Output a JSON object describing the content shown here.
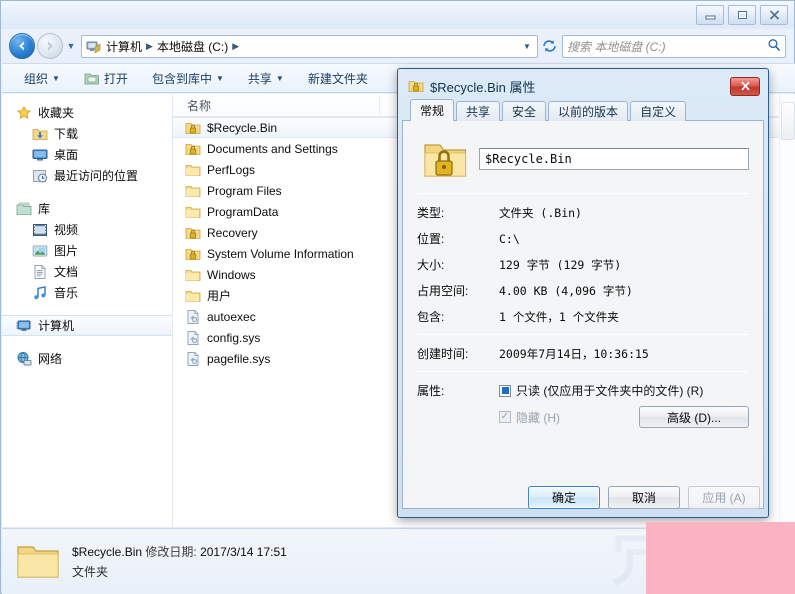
{
  "window": {
    "title_icon": "computer-icon",
    "buttons": {
      "minimize": "–",
      "maximize": "□",
      "close": "✕"
    }
  },
  "address": {
    "crumb_icon": "computer-drive-icon",
    "crumbs": [
      "计算机",
      "本地磁盘 (C:)"
    ],
    "separator": "▶",
    "dropdown": "▼",
    "refresh_icon": "refresh-icon"
  },
  "search": {
    "placeholder": "搜索 本地磁盘 (C:)",
    "icon": "search-icon"
  },
  "commandbar": {
    "items": [
      {
        "label": "组织",
        "caret": "▼",
        "icon": null
      },
      {
        "label": "打开",
        "caret": "",
        "icon": "open-folder-icon"
      },
      {
        "label": "包含到库中",
        "caret": "▼",
        "icon": null
      },
      {
        "label": "共享",
        "caret": "▼",
        "icon": null
      },
      {
        "label": "新建文件夹",
        "caret": "",
        "icon": null
      }
    ]
  },
  "navpane": {
    "groups": [
      {
        "header": {
          "label": "收藏夹",
          "icon": "star-icon"
        },
        "items": [
          {
            "label": "下载",
            "icon": "download-folder-icon"
          },
          {
            "label": "桌面",
            "icon": "desktop-icon"
          },
          {
            "label": "最近访问的位置",
            "icon": "recent-places-icon"
          }
        ]
      },
      {
        "header": {
          "label": "库",
          "icon": "library-icon"
        },
        "items": [
          {
            "label": "视频",
            "icon": "videos-icon"
          },
          {
            "label": "图片",
            "icon": "pictures-icon"
          },
          {
            "label": "文档",
            "icon": "documents-icon"
          },
          {
            "label": "音乐",
            "icon": "music-icon"
          }
        ]
      },
      {
        "header": {
          "label": "计算机",
          "icon": "computer-icon",
          "selected": true
        },
        "items": []
      },
      {
        "header": {
          "label": "网络",
          "icon": "network-icon"
        },
        "items": []
      }
    ]
  },
  "filelist": {
    "column_header": "名称",
    "sort_indicator": "▲",
    "rows": [
      {
        "name": "$Recycle.Bin",
        "icon": "locked-folder-icon",
        "selected": true
      },
      {
        "name": "Documents and Settings",
        "icon": "locked-folder-icon",
        "selected": false
      },
      {
        "name": "PerfLogs",
        "icon": "folder-icon",
        "selected": false
      },
      {
        "name": "Program Files",
        "icon": "folder-icon",
        "selected": false
      },
      {
        "name": "ProgramData",
        "icon": "folder-icon",
        "selected": false
      },
      {
        "name": "Recovery",
        "icon": "locked-folder-icon",
        "selected": false
      },
      {
        "name": "System Volume Information",
        "icon": "locked-folder-icon",
        "selected": false
      },
      {
        "name": "Windows",
        "icon": "folder-icon",
        "selected": false
      },
      {
        "name": "用户",
        "icon": "folder-icon",
        "selected": false
      },
      {
        "name": "autoexec",
        "icon": "system-file-icon",
        "selected": false
      },
      {
        "name": "config.sys",
        "icon": "system-file-icon",
        "selected": false
      },
      {
        "name": "pagefile.sys",
        "icon": "system-file-icon",
        "selected": false
      }
    ]
  },
  "details": {
    "icon": "folder-large-icon",
    "name": "$Recycle.Bin",
    "modified_label": "修改日期:",
    "modified_value": "2017/3/14 17:51",
    "type": "文件夹"
  },
  "dialog": {
    "title": "$Recycle.Bin 属性",
    "title_icon": "locked-folder-icon",
    "close_label": "✕",
    "tabs": [
      {
        "label": "常规",
        "active": true
      },
      {
        "label": "共享",
        "active": false
      },
      {
        "label": "安全",
        "active": false
      },
      {
        "label": "以前的版本",
        "active": false
      },
      {
        "label": "自定义",
        "active": false
      }
    ],
    "name_icon": "locked-folder-large-icon",
    "name_value": "$Recycle.Bin",
    "properties": [
      {
        "key": "类型:",
        "value": "文件夹 (.Bin)"
      },
      {
        "key": "位置:",
        "value": "C:\\"
      },
      {
        "key": "大小:",
        "value": "129 字节 (129 字节)"
      },
      {
        "key": "占用空间:",
        "value": "4.00 KB (4,096 字节)"
      },
      {
        "key": "包含:",
        "value": "1 个文件，1 个文件夹"
      }
    ],
    "created": {
      "key": "创建时间:",
      "value": "2009年7月14日，10:36:15"
    },
    "attributes": {
      "key": "属性:",
      "readonly": {
        "label": "只读 (仅应用于文件夹中的文件) (R)",
        "state": "indeterminate"
      },
      "hidden": {
        "label": "隐藏 (H)",
        "state": "checked-disabled",
        "mark": "✓"
      },
      "advanced_button": "高级 (D)..."
    },
    "buttons": {
      "ok": "确定",
      "cancel": "取消",
      "apply": "应用 (A)"
    }
  },
  "overlay": {
    "watermark_glyph": "冗",
    "pink_color": "#fbb3c4"
  }
}
